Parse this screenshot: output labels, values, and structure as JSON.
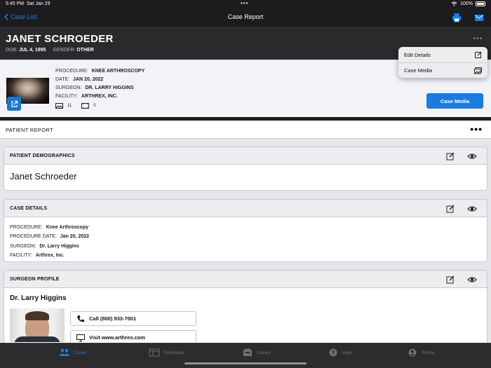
{
  "status_bar": {
    "time": "5:45 PM",
    "date": "Sat Jan 29",
    "battery": "100%"
  },
  "nav": {
    "back_label": "Case List",
    "title": "Case Report",
    "print_icon": "printer-icon",
    "mail_icon": "mail-icon"
  },
  "patient": {
    "name": "JANET SCHROEDER",
    "dob_label": "DOB:",
    "dob": "JUL 4, 1995",
    "gender_label": "GENDER:",
    "gender": "OTHER"
  },
  "case": {
    "procedure_label": "PROCEDURE:",
    "procedure": "KNEE ARTHROSCOPY",
    "date_label": "DATE:",
    "date": "JAN 20, 2022",
    "surgeon_label": "SURGEON:",
    "surgeon": "DR. LARRY HIGGINS",
    "facility_label": "FACILITY:",
    "facility": "ARTHREX, INC.",
    "image_count": "11",
    "video_count": "0",
    "media_button": "Case Media"
  },
  "menu": {
    "items": [
      {
        "label": "Edit Details",
        "icon": "edit-icon"
      },
      {
        "label": "Case Media",
        "icon": "media-icon"
      }
    ]
  },
  "report": {
    "title": "PATIENT REPORT"
  },
  "sections": {
    "demographics": {
      "title": "PATIENT DEMOGRAPHICS",
      "name": "Janet Schroeder"
    },
    "case_details": {
      "title": "CASE DETAILS",
      "procedure_label": "PROCEDURE:",
      "procedure": "Knee Arthroscopy",
      "date_label": "PROCEDURE DATE:",
      "date": "Jan 20, 2022",
      "surgeon_label": "SURGEON:",
      "surgeon": "Dr. Larry Higgins",
      "facility_label": "FACILITY:",
      "facility": "Arthrex, Inc."
    },
    "surgeon_profile": {
      "title": "SURGEON PROFILE",
      "name": "Dr. Larry Higgins",
      "call_label": "Call (800) 933-7001",
      "visit_label": "Visit www.arthrex.com"
    }
  },
  "tabs": [
    {
      "label": "Cases",
      "icon": "people-icon",
      "active": true
    },
    {
      "label": "Templates",
      "icon": "templates-icon",
      "active": false
    },
    {
      "label": "Library",
      "icon": "library-icon",
      "active": false
    },
    {
      "label": "Help",
      "icon": "help-icon",
      "active": false
    },
    {
      "label": "Profile",
      "icon": "profile-icon",
      "active": false
    }
  ],
  "colors": {
    "accent": "#1a7be0",
    "nav_link": "#0a84ff",
    "dark_bg": "#1c1c1e"
  }
}
